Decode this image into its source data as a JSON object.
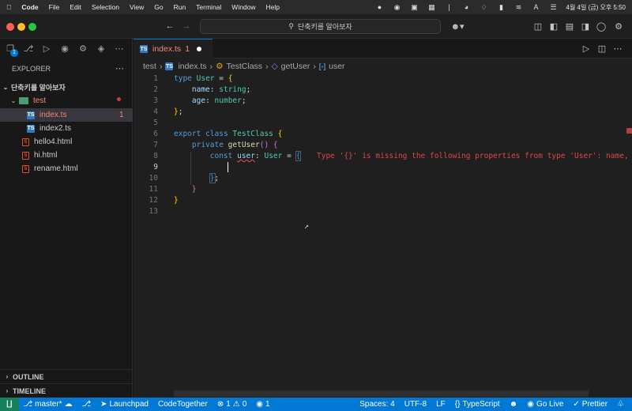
{
  "menubar": {
    "app": "Code",
    "items": [
      "File",
      "Edit",
      "Selection",
      "View",
      "Go",
      "Run",
      "Terminal",
      "Window",
      "Help"
    ],
    "clock": "4월 4일 (금) 오후 5:50"
  },
  "titlebar": {
    "search": "단축키를 알아보자"
  },
  "sidebar": {
    "title": "EXPLORER",
    "root": "단축키를 알아보자",
    "folder": "test",
    "files_in_folder": [
      {
        "name": "index.ts",
        "badge": "1",
        "type": "ts"
      },
      {
        "name": "index2.ts",
        "badge": "",
        "type": "ts"
      }
    ],
    "files": [
      {
        "name": "hello4.html",
        "type": "html"
      },
      {
        "name": "hi.html",
        "type": "html"
      },
      {
        "name": "rename.html",
        "type": "html"
      }
    ],
    "outline": "OUTLINE",
    "timeline": "TIMELINE",
    "activity_badge": "1"
  },
  "editor": {
    "tab_label": "index.ts",
    "tab_badge": "1",
    "breadcrumb": [
      "test",
      "index.ts",
      "TestClass",
      "getUser",
      "user"
    ],
    "error_message": "Type '{}' is missing the following properties from type 'User': name, a",
    "line_numbers": [
      "1",
      "2",
      "3",
      "4",
      "5",
      "6",
      "7",
      "8",
      "9",
      "10",
      "11",
      "12",
      "13"
    ],
    "current_line": "9"
  },
  "statusbar": {
    "branch": "master*",
    "launchpad": "Launchpad",
    "codetogether": "CodeTogether",
    "errors": "1",
    "warnings": "0",
    "ports": "1",
    "spaces": "Spaces: 4",
    "encoding": "UTF-8",
    "eol": "LF",
    "language": "TypeScript",
    "golive": "Go Live",
    "prettier": "Prettier"
  },
  "colors": {
    "accent": "#0078d4",
    "error": "#f14c4c",
    "folder": "#4a9c74"
  }
}
